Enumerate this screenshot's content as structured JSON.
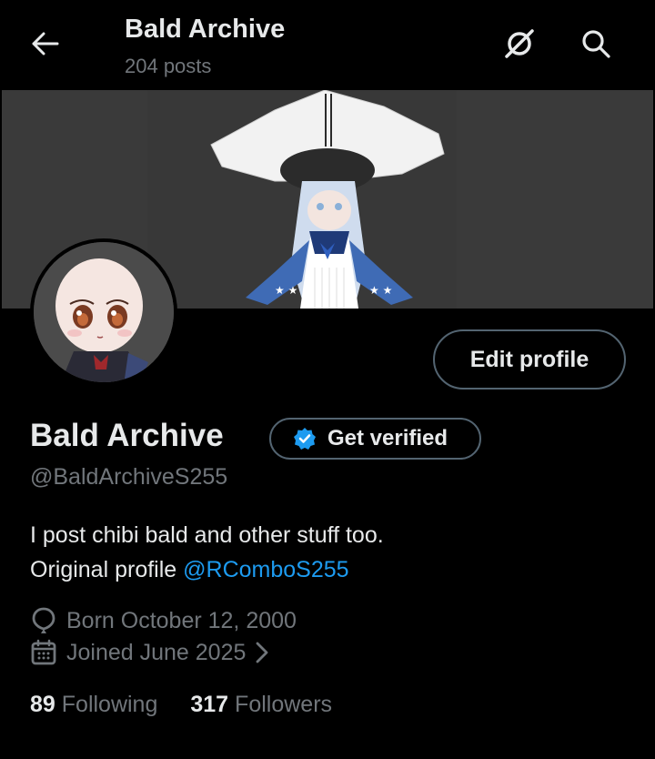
{
  "header": {
    "title": "Bald Archive",
    "post_count": "204 posts"
  },
  "profile": {
    "display_name": "Bald Archive",
    "handle": "@BaldArchiveS255",
    "edit_label": "Edit profile",
    "verify_label": "Get verified",
    "bio_line1": "I post chibi bald and other stuff too.",
    "bio_line2_prefix": "Original profile ",
    "bio_link": "@RComboS255",
    "birthday": "Born October 12, 2000",
    "joined": "Joined June 2025",
    "following_count": "89",
    "following_label": "Following",
    "followers_count": "317",
    "followers_label": "Followers"
  },
  "icons": {
    "back": "arrow-left-icon",
    "grok": "grok-icon",
    "search": "search-icon",
    "verified": "verified-badge-icon",
    "birthday": "balloon-icon",
    "calendar": "calendar-icon",
    "chevron": "chevron-right-icon"
  },
  "colors": {
    "background": "#000000",
    "text": "#e7e9ea",
    "secondary": "#71767b",
    "link": "#1d9bf0",
    "border": "#536471"
  }
}
